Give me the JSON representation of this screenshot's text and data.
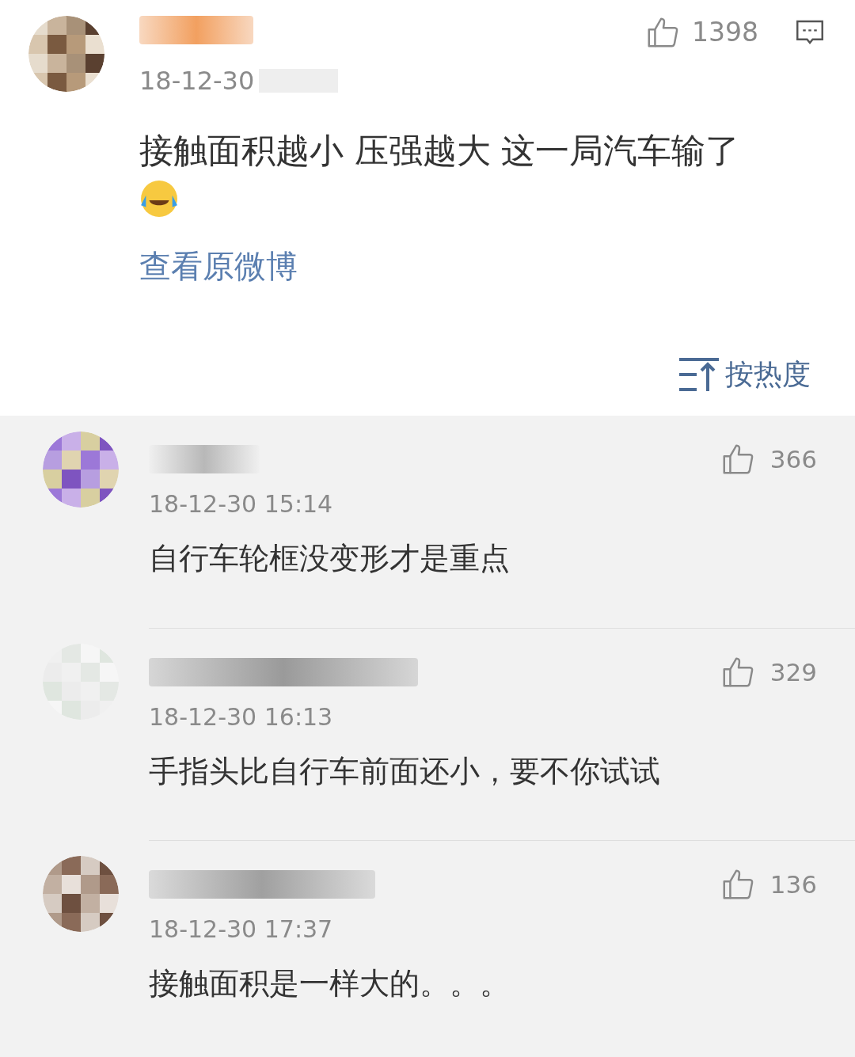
{
  "post": {
    "likes": "1398",
    "time": "18-12-30",
    "text": "接触面积越小 压强越大 这一局汽车输了",
    "link": "查看原微博"
  },
  "sort": {
    "label": "按热度"
  },
  "comments": [
    {
      "likes": "366",
      "time": "18-12-30 15:14",
      "text": "自行车轮框没变形才是重点"
    },
    {
      "likes": "329",
      "time": "18-12-30 16:13",
      "text": "手指头比自行车前面还小，要不你试试"
    },
    {
      "likes": "136",
      "time": "18-12-30 17:37",
      "text": "接触面积是一样大的。。。"
    }
  ]
}
